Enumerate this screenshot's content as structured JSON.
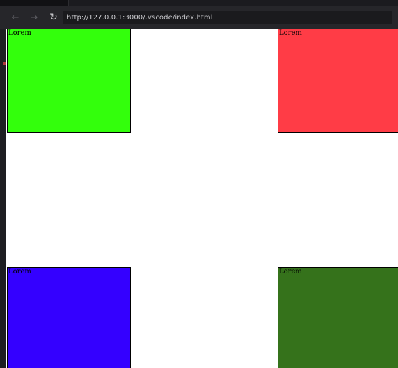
{
  "browser": {
    "back_icon": "arrow-left-icon",
    "forward_icon": "arrow-right-icon",
    "reload_icon": "reload-icon",
    "back_glyph": "←",
    "forward_glyph": "→",
    "reload_glyph": "↻",
    "url": "http://127.0.0.1:3000/.vscode/index.html"
  },
  "page": {
    "boxes": [
      {
        "label": "Lorem",
        "color": "#33ff0c"
      },
      {
        "label": "Lorem",
        "color": "#ff3c46"
      },
      {
        "label": "Lorem",
        "color": "#3400ff"
      },
      {
        "label": "Lorem",
        "color": "#35721b"
      }
    ]
  }
}
